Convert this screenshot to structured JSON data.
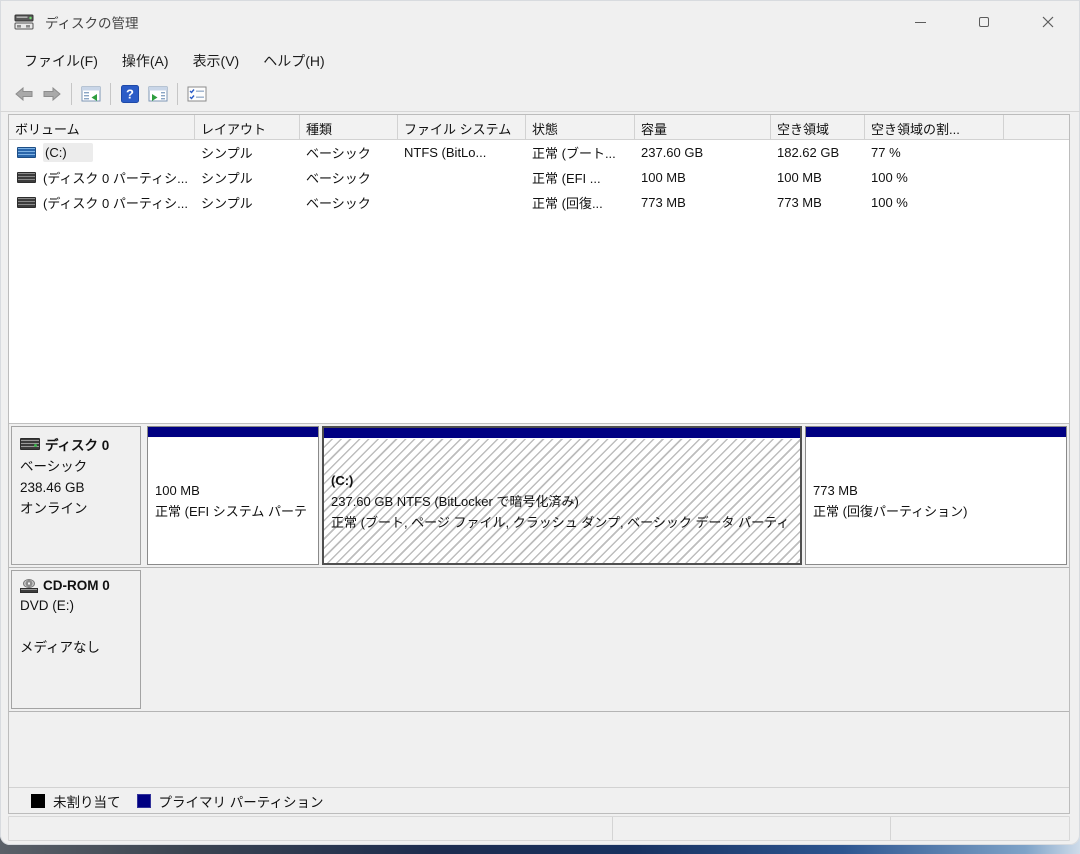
{
  "window": {
    "title": "ディスクの管理"
  },
  "menu": {
    "file": "ファイル(F)",
    "action": "操作(A)",
    "view": "表示(V)",
    "help": "ヘルプ(H)"
  },
  "toolbar": {
    "icons": [
      "back",
      "forward",
      "show-console-tree",
      "help",
      "show-action-pane",
      "properties-checklist"
    ]
  },
  "volume_table": {
    "columns": {
      "volume": "ボリューム",
      "layout": "レイアウト",
      "type": "種類",
      "filesystem": "ファイル システム",
      "status": "状態",
      "capacity": "容量",
      "free": "空き領域",
      "percent_free": "空き領域の割..."
    },
    "rows": [
      {
        "volume": "(C:)",
        "layout": "シンプル",
        "type": "ベーシック",
        "filesystem": "NTFS (BitLo...",
        "status": "正常 (ブート...",
        "capacity": "237.60 GB",
        "free": "182.62 GB",
        "percent_free": "77 %"
      },
      {
        "volume": "(ディスク 0 パーティシ...",
        "layout": "シンプル",
        "type": "ベーシック",
        "filesystem": "",
        "status": "正常 (EFI ...",
        "capacity": "100 MB",
        "free": "100 MB",
        "percent_free": "100 %"
      },
      {
        "volume": "(ディスク 0 パーティシ...",
        "layout": "シンプル",
        "type": "ベーシック",
        "filesystem": "",
        "status": "正常 (回復...",
        "capacity": "773 MB",
        "free": "773 MB",
        "percent_free": "100 %"
      }
    ]
  },
  "disk0": {
    "name": "ディスク 0",
    "kind": "ベーシック",
    "size": "238.46 GB",
    "status": "オンライン",
    "partitions": [
      {
        "size_line": "100 MB",
        "status_line": "正常 (EFI システム パーテ",
        "selected": false
      },
      {
        "label": "(C:)",
        "size_line": "237.60 GB NTFS (BitLocker で暗号化済み)",
        "status_line": "正常 (ブート, ページ ファイル, クラッシュ ダンプ, ベーシック データ パーティ",
        "selected": true
      },
      {
        "size_line": "773 MB",
        "status_line": "正常 (回復パーティション)",
        "selected": false
      }
    ]
  },
  "cdrom": {
    "name": "CD-ROM 0",
    "drive": "DVD (E:)",
    "media": "メディアなし"
  },
  "legend": {
    "unallocated": "未割り当て",
    "primary": "プライマリ パーティション"
  },
  "colors": {
    "partition_header": "#000082",
    "legend_unallocated": "#000000",
    "legend_primary": "#000082",
    "help_icon_blue": "#2b5cc7",
    "chrome": "#f0f0f0"
  }
}
